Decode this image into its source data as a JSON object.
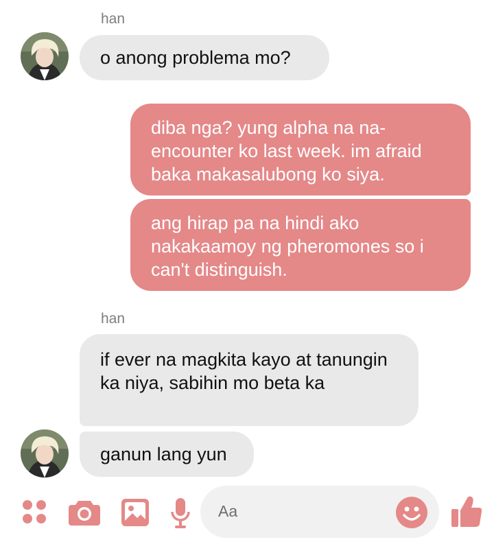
{
  "conversation": {
    "sender_name": "han",
    "messages": [
      {
        "from": "han",
        "text": "o anong problema mo?"
      },
      {
        "from": "me",
        "text": "diba nga? yung alpha na na-encounter ko last week. im afraid baka makasalubong ko siya."
      },
      {
        "from": "me",
        "text": "ang hirap pa na hindi ako nakakaamoy ng pheromones so i can't distinguish."
      },
      {
        "from": "han",
        "text": "if ever na magkita kayo at tanungin ka niya, sabihin mo beta ka"
      },
      {
        "from": "han",
        "text": "ganun lang yun"
      }
    ]
  },
  "composer": {
    "placeholder": "Aa",
    "icons": [
      "more-dots-icon",
      "camera-icon",
      "image-icon",
      "microphone-icon",
      "emoji-icon",
      "like-thumb-icon"
    ]
  },
  "colors": {
    "accent": "#e58888",
    "incoming_bubble": "#e9e9e9",
    "name_text": "#7d7d7d",
    "input_background": "#f1f1f1"
  }
}
